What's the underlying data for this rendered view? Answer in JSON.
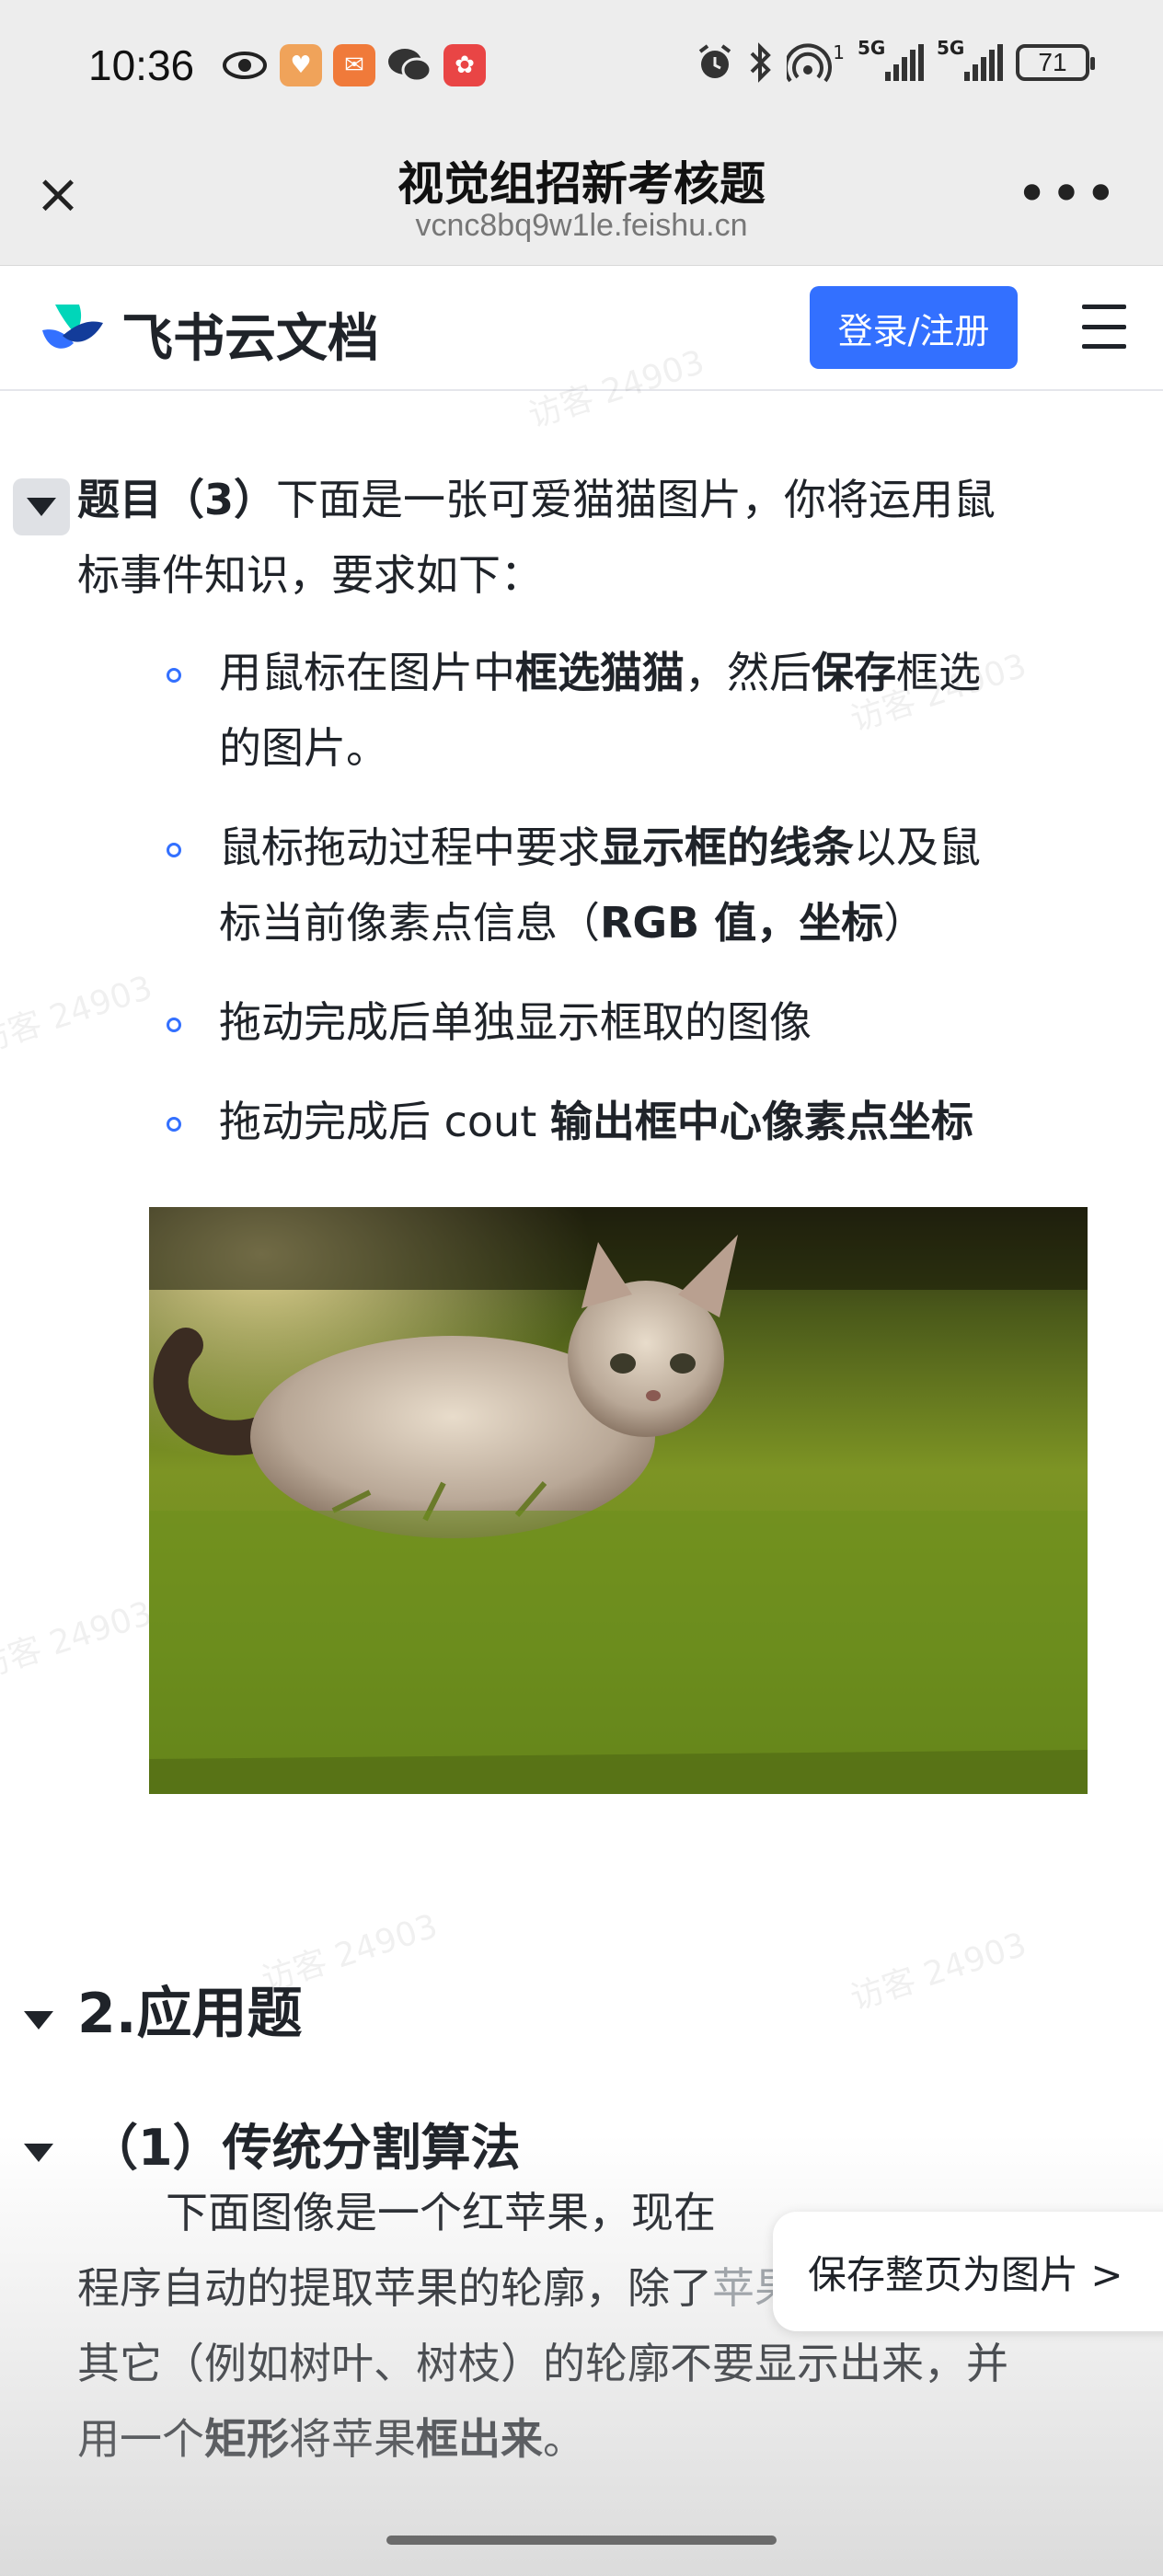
{
  "status": {
    "time": "10:36",
    "battery": "71",
    "net1": "5G",
    "net2": "5G",
    "sup": "1"
  },
  "titlebar": {
    "title": "视觉组招新考核题",
    "url": "vcnc8bq9w1le.feishu.cn"
  },
  "header": {
    "brand": "飞书云文档",
    "login": "登录/注册"
  },
  "q3": {
    "t_bold": "题目（3）",
    "t_rest": "下面是一张可爱猫猫图片，你将运用鼠",
    "t_line2": "标事件知识，要求如下：",
    "items": [
      {
        "a": "用鼠标在图片中",
        "b": "框选猫猫",
        "c": "，然后",
        "d": "保存",
        "e": "框选",
        "line2": "的图片。"
      },
      {
        "a": "鼠标拖动过程中要求",
        "b": "显示框的线条",
        "c": "以及鼠",
        "line2a": "标当前像素点信息（",
        "line2b": "RGB 值，坐标",
        "line2c": "）"
      },
      {
        "a": "拖动完成后单独显示框取的图像"
      },
      {
        "a": "拖动完成后 cout ",
        "b": "输出框中心像素点坐标"
      }
    ]
  },
  "section2": {
    "title": "2.应用题"
  },
  "sub1": {
    "title": "（1）传统分割算法",
    "line1": "下面图像是一个红苹果，现在",
    "line2": "程序自动的提取苹果的轮廓，除了",
    "line2tail": "苹果的轮廓，",
    "line3": "其它（例如树叶、树枝）的轮廓不要显示出来，并",
    "line4a": "用一个",
    "line4b": "矩形",
    "line4c": "将苹果",
    "line4d": "框出来",
    "line4e": "。"
  },
  "save_page": "保存整页为图片 >",
  "watermark": "访客 24903",
  "colors": {
    "accent": "#3370ff",
    "status_bg": "#ededed"
  }
}
